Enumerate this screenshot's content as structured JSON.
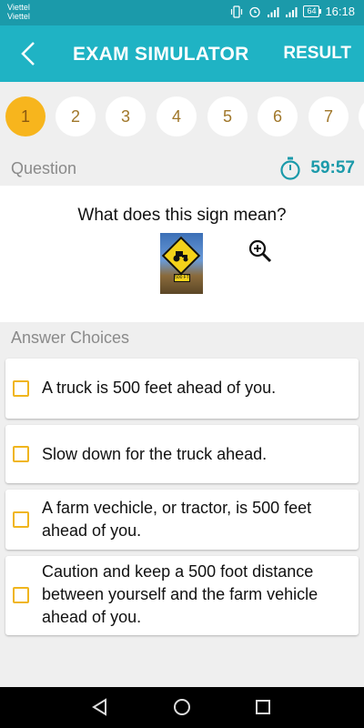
{
  "status_bar": {
    "carrier_line1": "Viettel",
    "carrier_line2": "Viettel",
    "battery": "64",
    "time": "16:18"
  },
  "app_bar": {
    "title": "EXAM SIMULATOR",
    "result_label": "RESULT",
    "back_icon": "chevron-left-icon"
  },
  "question_numbers": [
    "1",
    "2",
    "3",
    "4",
    "5",
    "6",
    "7"
  ],
  "active_question": "1",
  "question_section": {
    "label": "Question",
    "timer": "59:57",
    "text": "What does this sign mean?",
    "sign_plate_text": "500 FT"
  },
  "answers_section": {
    "label": "Answer Choices",
    "choices": [
      "A truck is 500 feet ahead of you.",
      "Slow down for the truck ahead.",
      "A farm vechicle, or tractor, is 500 feet ahead of you.",
      "Caution and keep a 500 foot distance between yourself and the farm vehicle ahead of you."
    ]
  },
  "colors": {
    "status_bar": "#1b9aaa",
    "app_bar": "#1fb3c4",
    "active_question": "#f7b51d",
    "question_number_text": "#a0772a",
    "checkbox_border": "#f0b51d",
    "timer": "#1b9aaa"
  }
}
